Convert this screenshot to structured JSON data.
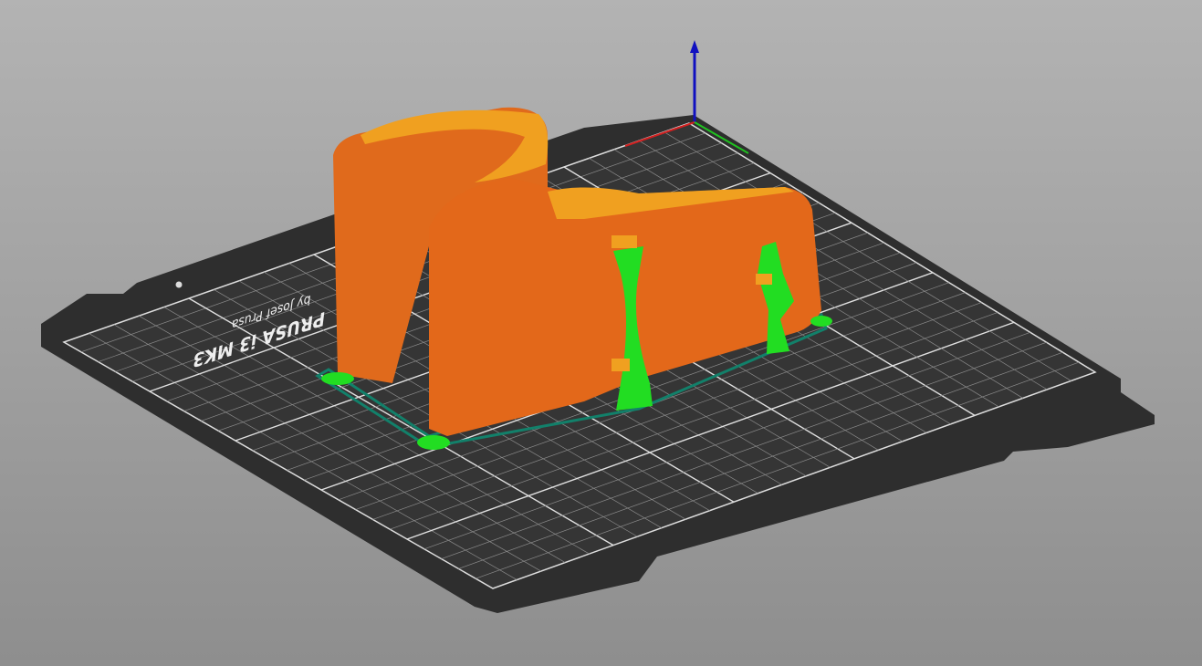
{
  "bed": {
    "logo_title": "PRUSA i3 MK3",
    "logo_subtitle": "by Josef Prusa"
  },
  "colors": {
    "bed": "#303030",
    "grid": "#d9d9d9",
    "perimeter": "#e06a1c",
    "top_layer": "#f0a020",
    "support": "#22dd22",
    "skirt": "#12806a",
    "axis_z": "#1010c0",
    "axis_x": "#d02020",
    "axis_y": "#20c020"
  }
}
